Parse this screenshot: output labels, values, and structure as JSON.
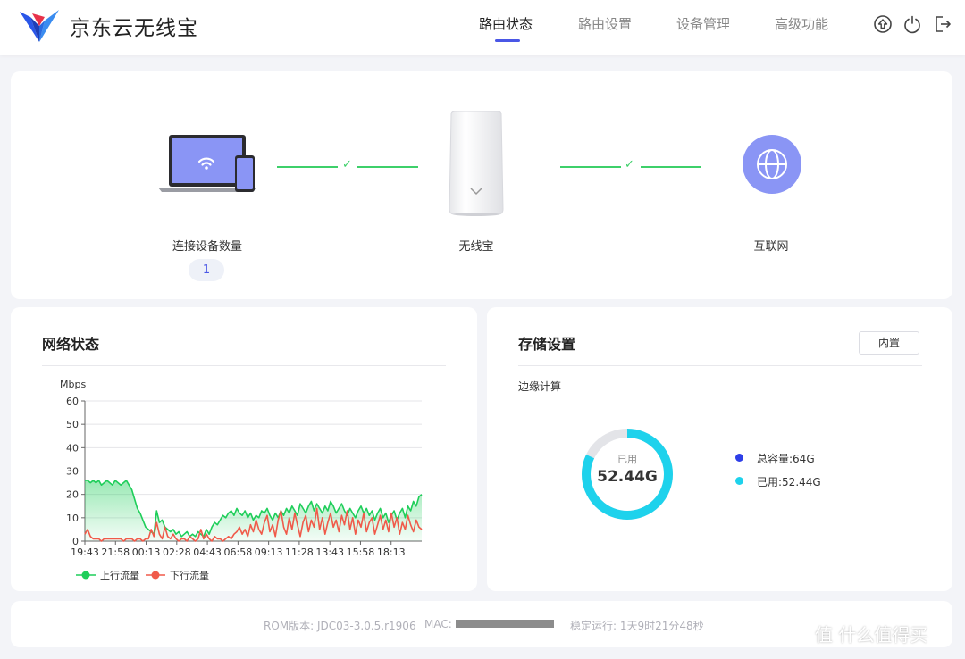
{
  "header": {
    "brand": "京东云无线宝",
    "nav": [
      "路由状态",
      "路由设置",
      "设备管理",
      "高级功能"
    ],
    "active_nav": "路由状态",
    "icons": [
      "upgrade-icon",
      "power-icon",
      "logout-icon"
    ],
    "accent_color": "#4a57e6"
  },
  "topology": {
    "device_label": "连接设备数量",
    "device_count": "1",
    "router_label": "无线宝",
    "internet_label": "互联网",
    "link_check": "✓",
    "link_color": "#3ed06a"
  },
  "network": {
    "title": "网络状态"
  },
  "chart_data": {
    "type": "line",
    "ylabel": "Mbps",
    "ylim": [
      0,
      60
    ],
    "yticks": [
      "0",
      "10",
      "20",
      "30",
      "40",
      "50",
      "60"
    ],
    "x_ticks": [
      "19:43",
      "21:58",
      "00:13",
      "02:28",
      "04:43",
      "06:58",
      "09:13",
      "11:28",
      "13:43",
      "15:58",
      "18:13"
    ],
    "grid": true,
    "legend": "bottom-left",
    "series": [
      {
        "name": "上行流量",
        "color": "#1fce5a",
        "fill": "area",
        "values": [
          26,
          26,
          25,
          26,
          25,
          26,
          24,
          25,
          26,
          25,
          24,
          26,
          25,
          24,
          25,
          26,
          24,
          22,
          18,
          14,
          12,
          9,
          6,
          5,
          4,
          3,
          13,
          8,
          9,
          6,
          5,
          4,
          5,
          3,
          4,
          2,
          3,
          4,
          2,
          3,
          2,
          4,
          3,
          2,
          5,
          3,
          6,
          8,
          7,
          9,
          11,
          10,
          12,
          13,
          11,
          14,
          12,
          11,
          13,
          10,
          12,
          9,
          11,
          10,
          13,
          12,
          14,
          11,
          9,
          12,
          10,
          13,
          11,
          14,
          12,
          15,
          13,
          11,
          16,
          14,
          12,
          15,
          17,
          13,
          16,
          14,
          12,
          15,
          13,
          17,
          15,
          12,
          14,
          16,
          13,
          11,
          14,
          12,
          10,
          13,
          15,
          12,
          14,
          11,
          13,
          9,
          12,
          14,
          10,
          12,
          8,
          11,
          13,
          9,
          12,
          14,
          10,
          15,
          13,
          17,
          15,
          19,
          20
        ]
      },
      {
        "name": "下行流量",
        "color": "#f05a4a",
        "fill": "none",
        "values": [
          3,
          5,
          2,
          1,
          1,
          1,
          0,
          1,
          1,
          1,
          1,
          1,
          1,
          1,
          0,
          1,
          1,
          1,
          0,
          1,
          1,
          0,
          1,
          1,
          5,
          2,
          8,
          3,
          1,
          6,
          2,
          1,
          3,
          1,
          0,
          1,
          1,
          0,
          2,
          1,
          0,
          1,
          5,
          1,
          3,
          1,
          0,
          2,
          1,
          1,
          0,
          1,
          2,
          1,
          3,
          4,
          6,
          3,
          5,
          2,
          7,
          4,
          9,
          5,
          3,
          8,
          11,
          4,
          7,
          2,
          9,
          13,
          6,
          3,
          10,
          5,
          12,
          7,
          2,
          8,
          11,
          4,
          9,
          6,
          14,
          5,
          10,
          3,
          8,
          12,
          6,
          9,
          4,
          11,
          7,
          13,
          5,
          10,
          3,
          9,
          6,
          12,
          4,
          8,
          10,
          3,
          7,
          11,
          5,
          9,
          4,
          12,
          6,
          10,
          3,
          8,
          5,
          11,
          7,
          4,
          9,
          6,
          5
        ]
      }
    ]
  },
  "storage": {
    "title": "存储设置",
    "mode_button": "内置",
    "section_label": "边缘计算",
    "used_label": "已用",
    "used_value": "52.44G",
    "used_fraction": 0.82,
    "legend_total": "总容量:64G",
    "legend_used": "已用:52.44G",
    "color_total": "#2e3fe8",
    "color_used": "#1ed2ec"
  },
  "footer": {
    "rom": "ROM版本: JDC03-3.0.5.r1906",
    "mac_label": "MAC:",
    "uptime": "稳定运行: 1天9时21分48秒"
  },
  "watermark": "值 什么值得买"
}
